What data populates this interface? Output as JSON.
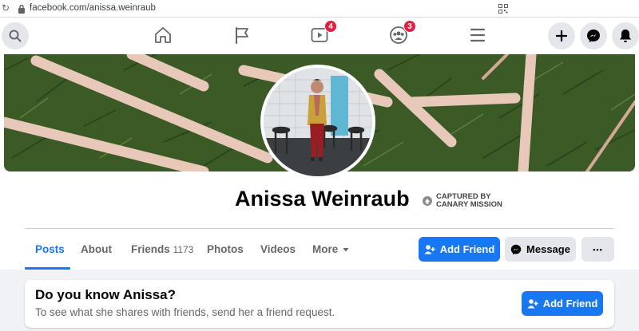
{
  "browser": {
    "url": "facebook.com/anissa.weinraub"
  },
  "nav": {
    "video_badge": "4",
    "groups_badge": "3"
  },
  "profile": {
    "name": "Anissa Weinraub",
    "watermark_line1": "CAPTURED BY",
    "watermark_line2": "CANARY MISSION"
  },
  "tabs": {
    "posts": "Posts",
    "about": "About",
    "friends": "Friends",
    "friends_count": "1173",
    "photos": "Photos",
    "videos": "Videos",
    "more": "More"
  },
  "actions": {
    "add_friend": "Add Friend",
    "message": "Message",
    "more_dots": "•••"
  },
  "card": {
    "title": "Do you know Anissa?",
    "subtitle": "To see what she shares with friends, send her a friend request.",
    "button": "Add Friend"
  },
  "colors": {
    "brand": "#1877f2",
    "badge": "#e41e3f"
  }
}
